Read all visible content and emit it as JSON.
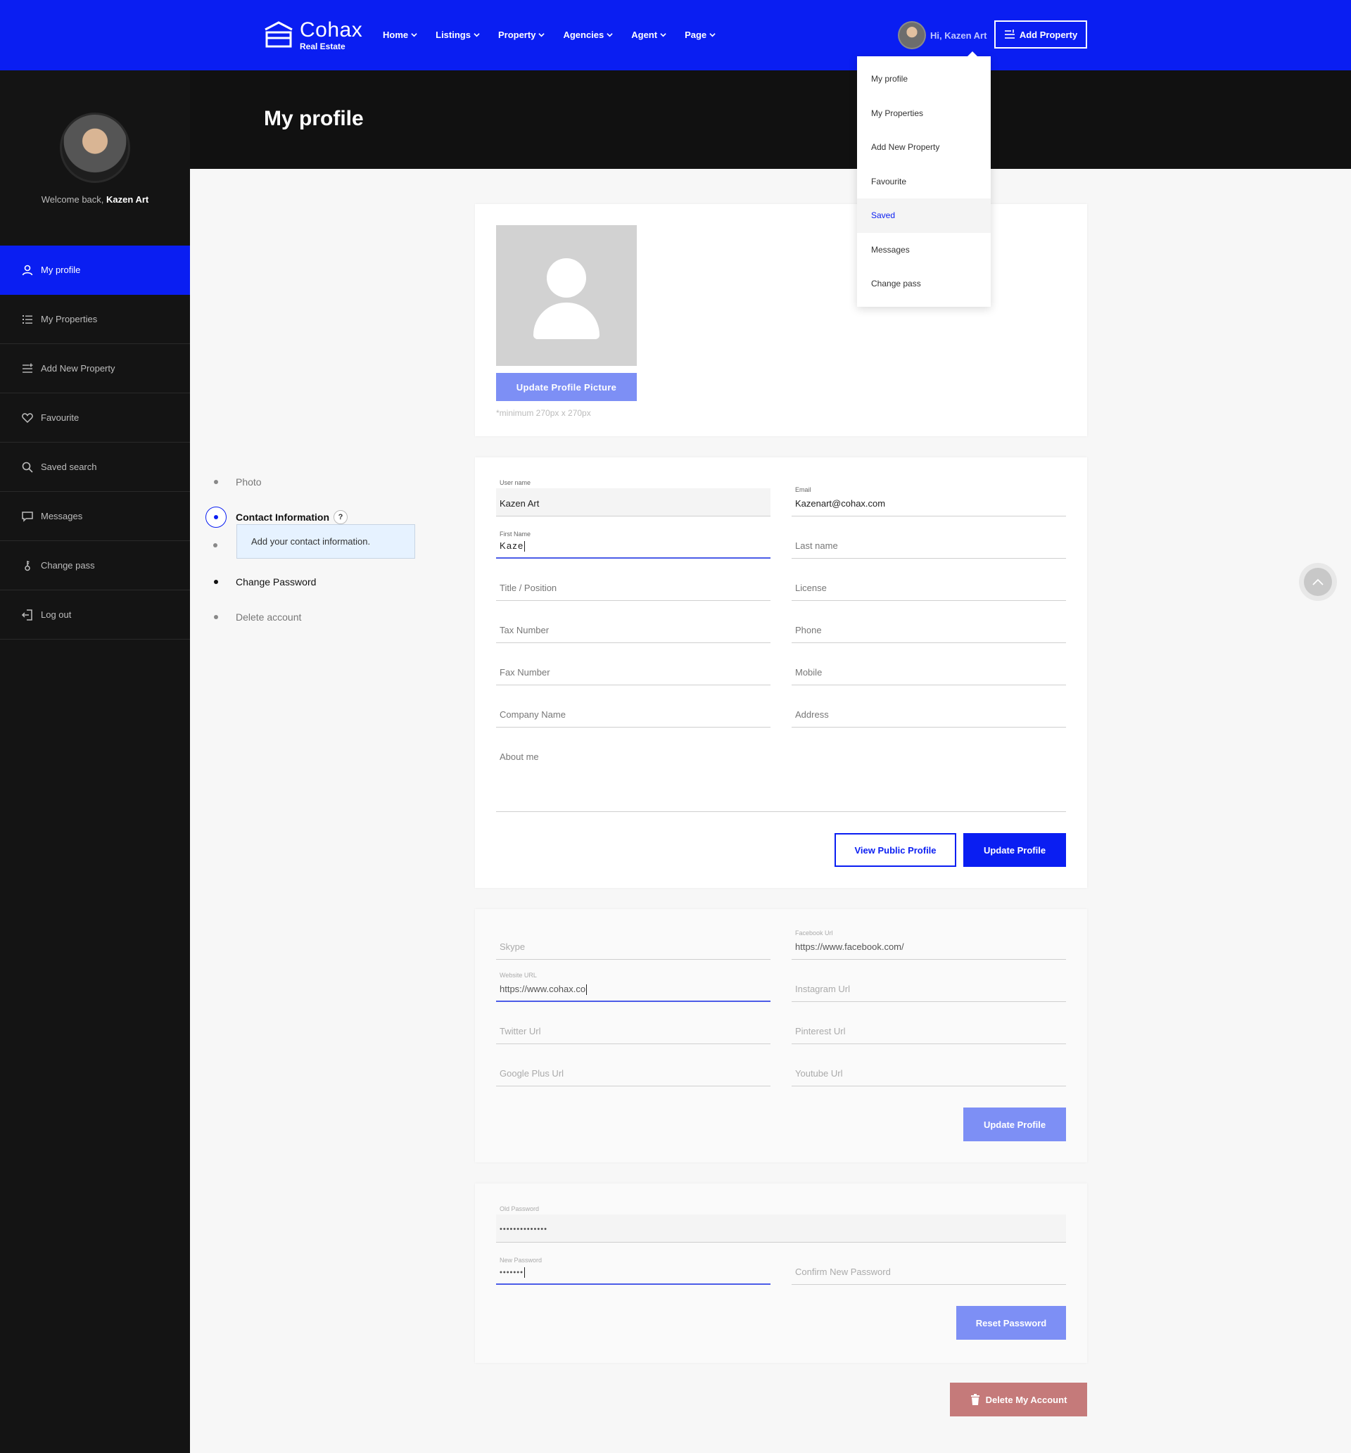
{
  "header": {
    "logo_name": "Cohax",
    "logo_sub": "Real Estate",
    "nav": [
      "Home",
      "Listings",
      "Property",
      "Agencies",
      "Agent",
      "Page"
    ],
    "user_greeting": "Hi, Kazen Art",
    "add_property_label": "Add Property",
    "brand_color": "#0a1ef2"
  },
  "dropdown": {
    "items": [
      "My profile",
      "My Properties",
      "Add New Property",
      "Favourite",
      "Saved",
      "Messages",
      "Change pass"
    ],
    "active_item": "Saved"
  },
  "page": {
    "title": "My profile"
  },
  "sidebar": {
    "welcome_prefix": "Welcome back,",
    "user_name": "Kazen Art",
    "items": [
      {
        "label": "My profile",
        "icon": "user-icon",
        "active": true
      },
      {
        "label": "My Properties",
        "icon": "list-icon",
        "active": false
      },
      {
        "label": "Add New Property",
        "icon": "add-list-icon",
        "active": false
      },
      {
        "label": "Favourite",
        "icon": "heart-icon",
        "active": false
      },
      {
        "label": "Saved search",
        "icon": "search-icon",
        "active": false
      },
      {
        "label": "Messages",
        "icon": "message-icon",
        "active": false
      },
      {
        "label": "Change pass",
        "icon": "key-icon",
        "active": false
      },
      {
        "label": "Log out",
        "icon": "logout-icon",
        "active": false
      }
    ]
  },
  "steps": {
    "photo": "Photo",
    "contact": "Contact Information",
    "help": "?",
    "tooltip": "Add your contact information.",
    "change_password": "Change Password",
    "delete_account": "Delete account"
  },
  "photo_card": {
    "button": "Update Profile Picture",
    "note": "*minimum 270px x 270px"
  },
  "contact_card": {
    "username_label": "User name",
    "username_value": "Kazen Art",
    "email_label": "Email",
    "email_value": "Kazenart@cohax.com",
    "firstname_label": "First Name",
    "firstname_value": "Kaze",
    "lastname_placeholder": "Last name",
    "title_placeholder": "Title / Position",
    "license_placeholder": "License",
    "tax_placeholder": "Tax Number",
    "phone_placeholder": "Phone",
    "fax_placeholder": "Fax Number",
    "mobile_placeholder": "Mobile",
    "company_placeholder": "Company Name",
    "address_placeholder": "Address",
    "about_placeholder": "About me",
    "view_public_button": "View Public Profile",
    "update_button": "Update Profile"
  },
  "social_card": {
    "skype_placeholder": "Skype",
    "facebook_label": "Facebook Url",
    "facebook_value": "https://www.facebook.com/",
    "website_label": "Website URL",
    "website_value": "https://www.cohax.co",
    "instagram_placeholder": "Instagram Url",
    "twitter_placeholder": "Twitter Url",
    "pinterest_placeholder": "Pinterest Url",
    "googleplus_placeholder": "Google Plus Url",
    "youtube_placeholder": "Youtube Url",
    "update_button": "Update Profile"
  },
  "password_card": {
    "old_label": "Old Password",
    "old_value": "••••••••••••••",
    "new_label": "New Password",
    "new_value": "•••••••",
    "confirm_placeholder": "Confirm New Password",
    "reset_button": "Reset Password"
  },
  "delete_button": "Delete My Account"
}
